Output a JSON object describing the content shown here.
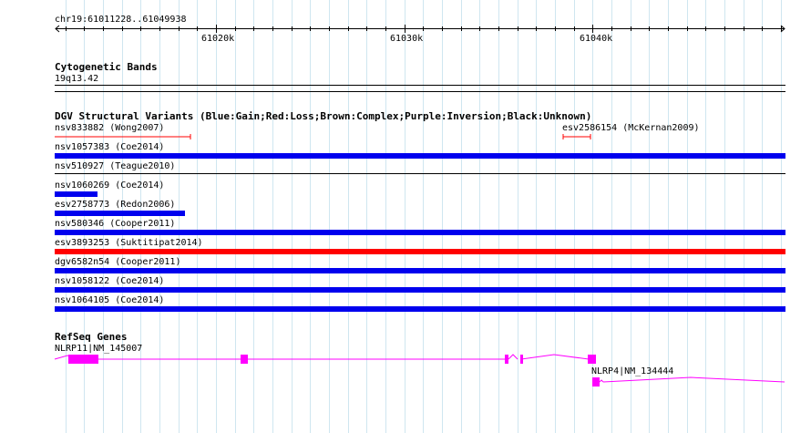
{
  "ruler": {
    "location": "chr19:61011228..61049938",
    "ticks": [
      "61020k",
      "61030k",
      "61040k"
    ]
  },
  "tracks": {
    "cytoband": {
      "title": "Cytogenetic Bands",
      "band": "19q13.42"
    },
    "dgv": {
      "title": "DGV Structural Variants (Blue:Gain;Red:Loss;Brown:Complex;Purple:Inversion;Black:Unknown)",
      "features": [
        {
          "label": "nsv833882 (Wong2007)",
          "type": "Loss",
          "color": "#ff0000"
        },
        {
          "label": "esv2586154 (McKernan2009)",
          "type": "Loss",
          "color": "#ff0000"
        },
        {
          "label": "nsv1057383 (Coe2014)",
          "type": "Gain",
          "color": "#0000ee"
        },
        {
          "label": "nsv510927 (Teague2010)",
          "type": "Unknown",
          "color": "#000000"
        },
        {
          "label": "nsv1060269 (Coe2014)",
          "type": "Gain",
          "color": "#0000ee"
        },
        {
          "label": "esv2758773 (Redon2006)",
          "type": "Gain",
          "color": "#0000ee"
        },
        {
          "label": "nsv580346 (Cooper2011)",
          "type": "Gain",
          "color": "#0000ee"
        },
        {
          "label": "esv3893253 (Suktitipat2014)",
          "type": "Loss",
          "color": "#ff0000"
        },
        {
          "label": "dgv6582n54 (Cooper2011)",
          "type": "Gain",
          "color": "#0000ee"
        },
        {
          "label": "nsv1058122 (Coe2014)",
          "type": "Gain",
          "color": "#0000ee"
        },
        {
          "label": "nsv1064105 (Coe2014)",
          "type": "Gain",
          "color": "#0000ee"
        }
      ]
    },
    "refseq": {
      "title": "RefSeq Genes",
      "genes": [
        {
          "label": "NLRP11|NM_145007",
          "color": "#ff00ff"
        },
        {
          "label": "NLRP4|NM_134444",
          "color": "#ff00ff"
        }
      ]
    }
  },
  "colors": {
    "grid": "#cfe6f0",
    "gain": "#0000ee",
    "loss": "#ff0000",
    "gene": "#ff00ff"
  }
}
